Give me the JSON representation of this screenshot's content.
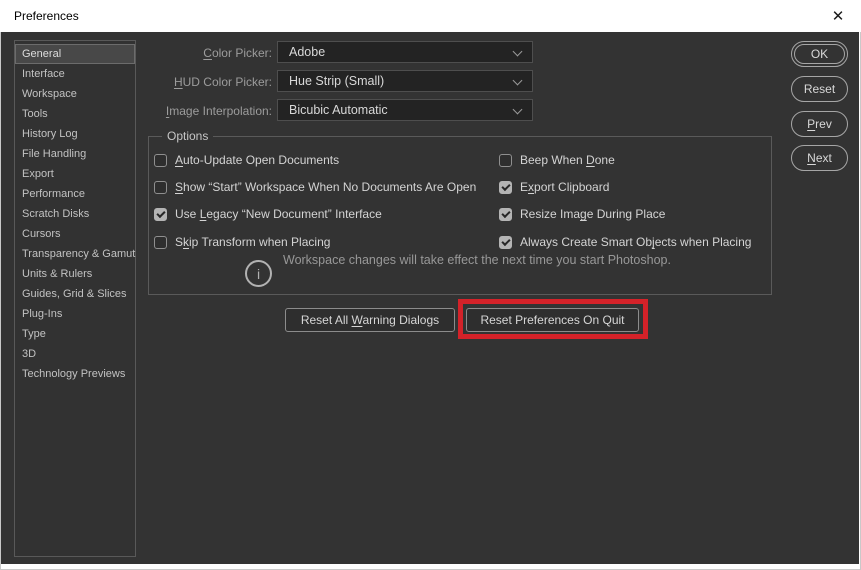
{
  "window": {
    "title": "Preferences",
    "close_glyph": "✕"
  },
  "colors": {
    "dialog_bg": "#333333",
    "titlebar_bg": "#ffffff",
    "annotation_red": "#d42229",
    "checkbox_checked": "#b4b4b4",
    "selected_item_bg": "#484848"
  },
  "sidebar": {
    "selected": "General",
    "items": [
      {
        "label": "General",
        "selected": true
      },
      {
        "label": "Interface",
        "selected": false
      },
      {
        "label": "Workspace",
        "selected": false
      },
      {
        "label": "Tools",
        "selected": false
      },
      {
        "label": "History Log",
        "selected": false
      },
      {
        "label": "File Handling",
        "selected": false
      },
      {
        "label": "Export",
        "selected": false
      },
      {
        "label": "Performance",
        "selected": false
      },
      {
        "label": "Scratch Disks",
        "selected": false
      },
      {
        "label": "Cursors",
        "selected": false
      },
      {
        "label": "Transparency & Gamut",
        "selected": false
      },
      {
        "label": "Units & Rulers",
        "selected": false
      },
      {
        "label": "Guides, Grid & Slices",
        "selected": false
      },
      {
        "label": "Plug-Ins",
        "selected": false
      },
      {
        "label": "Type",
        "selected": false
      },
      {
        "label": "3D",
        "selected": false
      },
      {
        "label": "Technology Previews",
        "selected": false
      }
    ]
  },
  "form": {
    "rows": [
      {
        "label": {
          "pre": "",
          "key": "C",
          "post": "olor Picker:"
        },
        "value": "Adobe"
      },
      {
        "label": {
          "pre": "",
          "key": "H",
          "post": "UD Color Picker:"
        },
        "value": "Hue Strip (Small)"
      },
      {
        "label": {
          "pre": "",
          "key": "I",
          "post": "mage Interpolation:"
        },
        "value": "Bicubic Automatic"
      }
    ]
  },
  "options": {
    "title": "Options",
    "info_glyph": "i",
    "note": "Workspace changes will take effect the next time you start Photoshop.",
    "left": [
      {
        "checked": false,
        "label": {
          "pre": "",
          "key": "A",
          "post": "uto-Update Open Documents"
        }
      },
      {
        "checked": false,
        "label": {
          "pre": "",
          "key": "S",
          "post": "how “Start” Workspace When No Documents Are Open"
        }
      },
      {
        "checked": true,
        "label": {
          "pre": "Use ",
          "key": "L",
          "post": "egacy “New Document” Interface"
        }
      },
      {
        "checked": false,
        "label": {
          "pre": "S",
          "key": "k",
          "post": "ip Transform when Placing"
        }
      }
    ],
    "right": [
      {
        "checked": false,
        "label": {
          "pre": "Beep When ",
          "key": "D",
          "post": "one"
        }
      },
      {
        "checked": true,
        "label": {
          "pre": "E",
          "key": "x",
          "post": "port Clipboard"
        }
      },
      {
        "checked": true,
        "label": {
          "pre": "Resize Ima",
          "key": "g",
          "post": "e During Place"
        }
      },
      {
        "checked": true,
        "label": {
          "pre": "Always Create Smart Ob",
          "key": "j",
          "post": "ects when Placing"
        }
      }
    ]
  },
  "footer_buttons": [
    {
      "label": {
        "pre": "Reset All ",
        "key": "W",
        "post": "arning Dialogs"
      }
    },
    {
      "label": {
        "pre": "Reset Preferences On Quit",
        "key": "",
        "post": ""
      }
    }
  ],
  "action_buttons": [
    {
      "label": {
        "pre": "OK",
        "key": "",
        "post": ""
      }
    },
    {
      "label": {
        "pre": "Reset",
        "key": "",
        "post": ""
      }
    },
    {
      "label": {
        "pre": "",
        "key": "P",
        "post": "rev"
      }
    },
    {
      "label": {
        "pre": "",
        "key": "N",
        "post": "ext"
      }
    }
  ]
}
